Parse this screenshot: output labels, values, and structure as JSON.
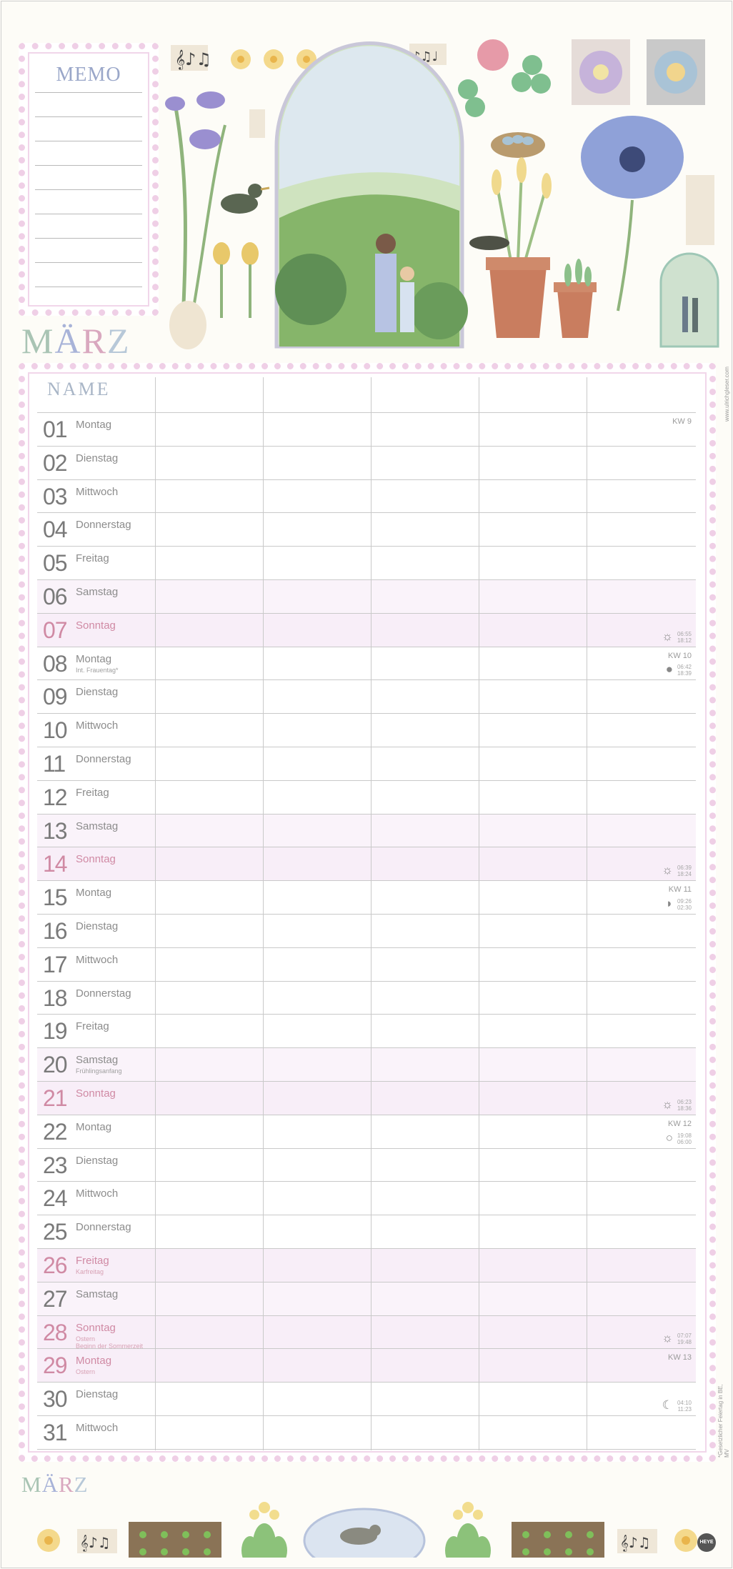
{
  "memo": {
    "title": "MEMO"
  },
  "month": {
    "name": "MÄRZ",
    "letter_colors": [
      "#a9c4b4",
      "#a8b3d8",
      "#d9a8bf",
      "#b7c8d8"
    ]
  },
  "table": {
    "name_header": "NAME",
    "columns": 5,
    "days": [
      {
        "num": "01",
        "name": "Montag",
        "note": "",
        "kw": "KW 9",
        "sun": "",
        "moon": "",
        "type": "normal"
      },
      {
        "num": "02",
        "name": "Dienstag",
        "note": "",
        "kw": "",
        "type": "normal"
      },
      {
        "num": "03",
        "name": "Mittwoch",
        "note": "",
        "kw": "",
        "type": "normal"
      },
      {
        "num": "04",
        "name": "Donnerstag",
        "note": "",
        "kw": "",
        "type": "normal"
      },
      {
        "num": "05",
        "name": "Freitag",
        "note": "",
        "kw": "",
        "type": "normal"
      },
      {
        "num": "06",
        "name": "Samstag",
        "note": "",
        "kw": "",
        "type": "weekend"
      },
      {
        "num": "07",
        "name": "Sonntag",
        "note": "",
        "kw": "",
        "type": "sunday",
        "sun_icon": "sun-icon",
        "times": "06:55 / 18:12"
      },
      {
        "num": "08",
        "name": "Montag",
        "note": "Int. Frauentag*",
        "kw": "KW 10",
        "type": "normal",
        "moon_icon": "full-moon-icon",
        "times": "06:42 / 18:39"
      },
      {
        "num": "09",
        "name": "Dienstag",
        "note": "",
        "kw": "",
        "type": "normal"
      },
      {
        "num": "10",
        "name": "Mittwoch",
        "note": "",
        "kw": "",
        "type": "normal"
      },
      {
        "num": "11",
        "name": "Donnerstag",
        "note": "",
        "kw": "",
        "type": "normal"
      },
      {
        "num": "12",
        "name": "Freitag",
        "note": "",
        "kw": "",
        "type": "normal"
      },
      {
        "num": "13",
        "name": "Samstag",
        "note": "",
        "kw": "",
        "type": "weekend"
      },
      {
        "num": "14",
        "name": "Sonntag",
        "note": "",
        "kw": "",
        "type": "sunday",
        "sun_icon": "sun-icon",
        "times": "06:39 / 18:24"
      },
      {
        "num": "15",
        "name": "Montag",
        "note": "",
        "kw": "KW 11",
        "type": "normal",
        "moon_icon": "half-moon-icon",
        "times": "09:26 / 02:30"
      },
      {
        "num": "16",
        "name": "Dienstag",
        "note": "",
        "kw": "",
        "type": "normal"
      },
      {
        "num": "17",
        "name": "Mittwoch",
        "note": "",
        "kw": "",
        "type": "normal"
      },
      {
        "num": "18",
        "name": "Donnerstag",
        "note": "",
        "kw": "",
        "type": "normal"
      },
      {
        "num": "19",
        "name": "Freitag",
        "note": "",
        "kw": "",
        "type": "normal"
      },
      {
        "num": "20",
        "name": "Samstag",
        "note": "Frühlingsanfang",
        "kw": "",
        "type": "weekend"
      },
      {
        "num": "21",
        "name": "Sonntag",
        "note": "",
        "kw": "",
        "type": "sunday",
        "sun_icon": "sun-icon",
        "times": "06:23 / 18:36"
      },
      {
        "num": "22",
        "name": "Montag",
        "note": "",
        "kw": "KW 12",
        "type": "normal",
        "moon_icon": "new-moon-icon",
        "times": "19:08 / 06:00"
      },
      {
        "num": "23",
        "name": "Dienstag",
        "note": "",
        "kw": "",
        "type": "normal"
      },
      {
        "num": "24",
        "name": "Mittwoch",
        "note": "",
        "kw": "",
        "type": "normal"
      },
      {
        "num": "25",
        "name": "Donnerstag",
        "note": "",
        "kw": "",
        "type": "normal"
      },
      {
        "num": "26",
        "name": "Freitag",
        "note": "Karfreitag",
        "kw": "",
        "type": "holiday"
      },
      {
        "num": "27",
        "name": "Samstag",
        "note": "",
        "kw": "",
        "type": "weekend"
      },
      {
        "num": "28",
        "name": "Sonntag",
        "note": "Ostern\nBeginn der Sommerzeit",
        "kw": "",
        "type": "sunday",
        "sun_icon": "sun-icon",
        "times": "07:07 / 19:48"
      },
      {
        "num": "29",
        "name": "Montag",
        "note": "Ostern",
        "kw": "KW 13",
        "type": "holiday"
      },
      {
        "num": "30",
        "name": "Dienstag",
        "note": "",
        "kw": "",
        "type": "normal",
        "moon_icon": "crescent-moon-icon",
        "times": "04:10 / 11:23"
      },
      {
        "num": "31",
        "name": "Mittwoch",
        "note": "",
        "kw": "",
        "type": "normal"
      }
    ]
  },
  "side_right_top": "www.ulrichgleser.com",
  "side_right_bottom": "*Gesetzlicher Feiertag in BE, MV",
  "footer": {
    "month": "MÄRZ",
    "logo": "HEYE"
  }
}
